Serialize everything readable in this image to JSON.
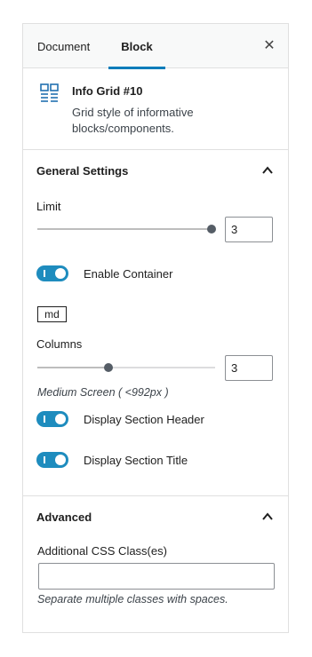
{
  "tabs": {
    "document": "Document",
    "block": "Block",
    "close": "✕"
  },
  "block_card": {
    "icon": "grid-block-icon",
    "title": "Info Grid #10",
    "description": "Grid style of informative blocks/components."
  },
  "general_settings": {
    "title": "General Settings",
    "expanded": true,
    "limit": {
      "label": "Limit",
      "value": "3",
      "slider_fraction": 0.98
    },
    "enable_container": {
      "label": "Enable Container",
      "checked": true
    },
    "breakpoint_badge": "md",
    "columns": {
      "label": "Columns",
      "value": "3",
      "slider_fraction": 0.4
    },
    "screen_help": "Medium Screen ( <992px )",
    "display_section_header": {
      "label": "Display Section Header",
      "checked": true
    },
    "display_section_title": {
      "label": "Display Section Title",
      "checked": true
    }
  },
  "advanced": {
    "title": "Advanced",
    "expanded": true,
    "css_class_label": "Additional CSS Class(es)",
    "css_class_value": "",
    "css_class_help": "Separate multiple classes with spaces."
  },
  "colors": {
    "accent": "#007cba",
    "toggle_on": "#1e8cbe"
  }
}
